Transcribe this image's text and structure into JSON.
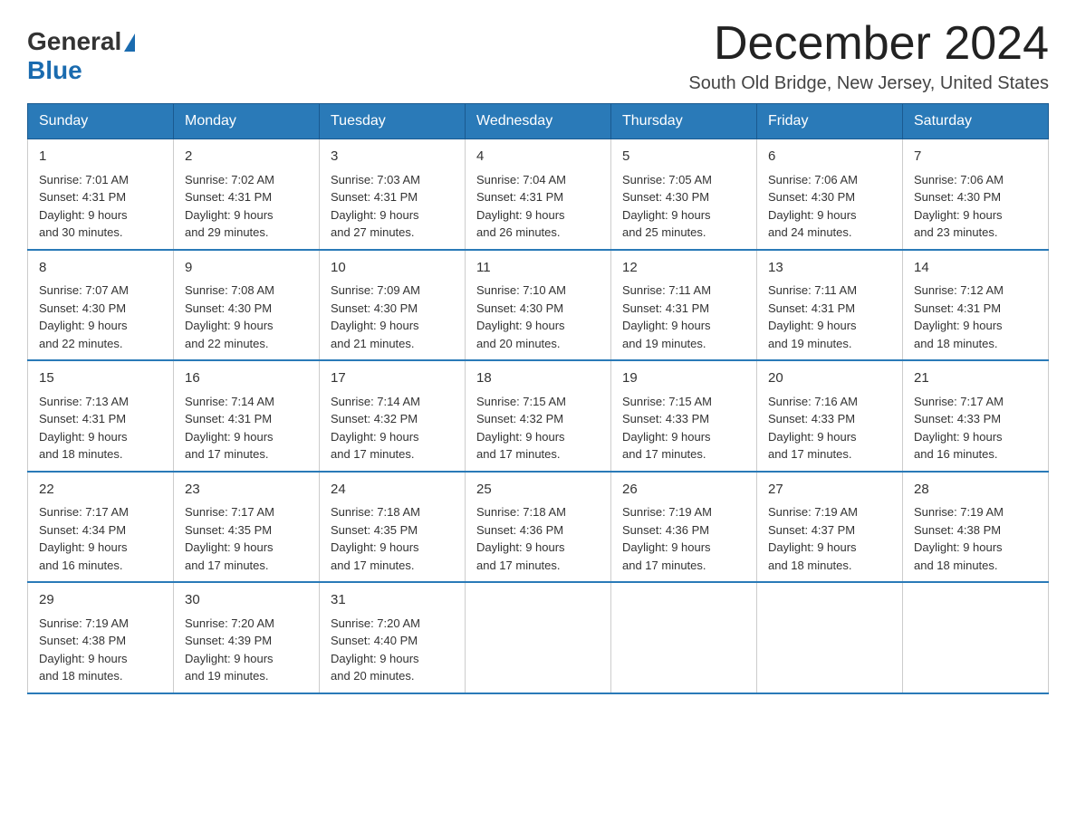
{
  "header": {
    "logo_general": "General",
    "logo_blue": "Blue",
    "month_year": "December 2024",
    "location": "South Old Bridge, New Jersey, United States"
  },
  "days_of_week": [
    "Sunday",
    "Monday",
    "Tuesday",
    "Wednesday",
    "Thursday",
    "Friday",
    "Saturday"
  ],
  "weeks": [
    [
      {
        "day": "1",
        "sunrise": "7:01 AM",
        "sunset": "4:31 PM",
        "daylight": "9 hours and 30 minutes."
      },
      {
        "day": "2",
        "sunrise": "7:02 AM",
        "sunset": "4:31 PM",
        "daylight": "9 hours and 29 minutes."
      },
      {
        "day": "3",
        "sunrise": "7:03 AM",
        "sunset": "4:31 PM",
        "daylight": "9 hours and 27 minutes."
      },
      {
        "day": "4",
        "sunrise": "7:04 AM",
        "sunset": "4:31 PM",
        "daylight": "9 hours and 26 minutes."
      },
      {
        "day": "5",
        "sunrise": "7:05 AM",
        "sunset": "4:30 PM",
        "daylight": "9 hours and 25 minutes."
      },
      {
        "day": "6",
        "sunrise": "7:06 AM",
        "sunset": "4:30 PM",
        "daylight": "9 hours and 24 minutes."
      },
      {
        "day": "7",
        "sunrise": "7:06 AM",
        "sunset": "4:30 PM",
        "daylight": "9 hours and 23 minutes."
      }
    ],
    [
      {
        "day": "8",
        "sunrise": "7:07 AM",
        "sunset": "4:30 PM",
        "daylight": "9 hours and 22 minutes."
      },
      {
        "day": "9",
        "sunrise": "7:08 AM",
        "sunset": "4:30 PM",
        "daylight": "9 hours and 22 minutes."
      },
      {
        "day": "10",
        "sunrise": "7:09 AM",
        "sunset": "4:30 PM",
        "daylight": "9 hours and 21 minutes."
      },
      {
        "day": "11",
        "sunrise": "7:10 AM",
        "sunset": "4:30 PM",
        "daylight": "9 hours and 20 minutes."
      },
      {
        "day": "12",
        "sunrise": "7:11 AM",
        "sunset": "4:31 PM",
        "daylight": "9 hours and 19 minutes."
      },
      {
        "day": "13",
        "sunrise": "7:11 AM",
        "sunset": "4:31 PM",
        "daylight": "9 hours and 19 minutes."
      },
      {
        "day": "14",
        "sunrise": "7:12 AM",
        "sunset": "4:31 PM",
        "daylight": "9 hours and 18 minutes."
      }
    ],
    [
      {
        "day": "15",
        "sunrise": "7:13 AM",
        "sunset": "4:31 PM",
        "daylight": "9 hours and 18 minutes."
      },
      {
        "day": "16",
        "sunrise": "7:14 AM",
        "sunset": "4:31 PM",
        "daylight": "9 hours and 17 minutes."
      },
      {
        "day": "17",
        "sunrise": "7:14 AM",
        "sunset": "4:32 PM",
        "daylight": "9 hours and 17 minutes."
      },
      {
        "day": "18",
        "sunrise": "7:15 AM",
        "sunset": "4:32 PM",
        "daylight": "9 hours and 17 minutes."
      },
      {
        "day": "19",
        "sunrise": "7:15 AM",
        "sunset": "4:33 PM",
        "daylight": "9 hours and 17 minutes."
      },
      {
        "day": "20",
        "sunrise": "7:16 AM",
        "sunset": "4:33 PM",
        "daylight": "9 hours and 17 minutes."
      },
      {
        "day": "21",
        "sunrise": "7:17 AM",
        "sunset": "4:33 PM",
        "daylight": "9 hours and 16 minutes."
      }
    ],
    [
      {
        "day": "22",
        "sunrise": "7:17 AM",
        "sunset": "4:34 PM",
        "daylight": "9 hours and 16 minutes."
      },
      {
        "day": "23",
        "sunrise": "7:17 AM",
        "sunset": "4:35 PM",
        "daylight": "9 hours and 17 minutes."
      },
      {
        "day": "24",
        "sunrise": "7:18 AM",
        "sunset": "4:35 PM",
        "daylight": "9 hours and 17 minutes."
      },
      {
        "day": "25",
        "sunrise": "7:18 AM",
        "sunset": "4:36 PM",
        "daylight": "9 hours and 17 minutes."
      },
      {
        "day": "26",
        "sunrise": "7:19 AM",
        "sunset": "4:36 PM",
        "daylight": "9 hours and 17 minutes."
      },
      {
        "day": "27",
        "sunrise": "7:19 AM",
        "sunset": "4:37 PM",
        "daylight": "9 hours and 18 minutes."
      },
      {
        "day": "28",
        "sunrise": "7:19 AM",
        "sunset": "4:38 PM",
        "daylight": "9 hours and 18 minutes."
      }
    ],
    [
      {
        "day": "29",
        "sunrise": "7:19 AM",
        "sunset": "4:38 PM",
        "daylight": "9 hours and 18 minutes."
      },
      {
        "day": "30",
        "sunrise": "7:20 AM",
        "sunset": "4:39 PM",
        "daylight": "9 hours and 19 minutes."
      },
      {
        "day": "31",
        "sunrise": "7:20 AM",
        "sunset": "4:40 PM",
        "daylight": "9 hours and 20 minutes."
      },
      null,
      null,
      null,
      null
    ]
  ],
  "labels": {
    "sunrise": "Sunrise:",
    "sunset": "Sunset:",
    "daylight": "Daylight:"
  }
}
